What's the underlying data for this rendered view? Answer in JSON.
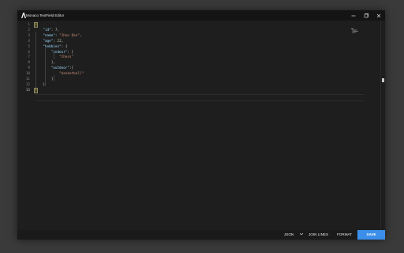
{
  "window": {
    "title": "Monaco TextField Editor",
    "controls": [
      "minimize-icon",
      "restore-icon",
      "close-icon"
    ]
  },
  "editor": {
    "language": "JSON",
    "active_line": 13,
    "line_numbers": [
      "1",
      "2",
      "3",
      "4",
      "5",
      "6",
      "7",
      "8",
      "9",
      "10",
      "11",
      "12",
      "13"
    ],
    "lines": [
      [
        {
          "t": "{",
          "c": "brace"
        }
      ],
      [
        {
          "t": "    ",
          "c": "punc"
        },
        {
          "t": "\"id\"",
          "c": "key"
        },
        {
          "t": ": ",
          "c": "punc"
        },
        {
          "t": "7",
          "c": "num"
        },
        {
          "t": ",",
          "c": "punc"
        }
      ],
      [
        {
          "t": "    ",
          "c": "punc"
        },
        {
          "t": "\"name\"",
          "c": "key"
        },
        {
          "t": ": ",
          "c": "punc"
        },
        {
          "t": "\"Jhon Doe\"",
          "c": "str"
        },
        {
          "t": ",",
          "c": "punc"
        }
      ],
      [
        {
          "t": "    ",
          "c": "punc"
        },
        {
          "t": "\"age\"",
          "c": "key"
        },
        {
          "t": ": ",
          "c": "punc"
        },
        {
          "t": "22",
          "c": "num"
        },
        {
          "t": ",",
          "c": "punc"
        }
      ],
      [
        {
          "t": "    ",
          "c": "punc"
        },
        {
          "t": "\"hobbies\"",
          "c": "key"
        },
        {
          "t": ": {",
          "c": "punc"
        }
      ],
      [
        {
          "t": "        ",
          "c": "punc"
        },
        {
          "t": "\"indoor\"",
          "c": "key"
        },
        {
          "t": ": [",
          "c": "punc"
        }
      ],
      [
        {
          "t": "            ",
          "c": "punc"
        },
        {
          "t": "\"Chess\"",
          "c": "str"
        }
      ],
      [
        {
          "t": "        ],",
          "c": "punc"
        }
      ],
      [
        {
          "t": "        ",
          "c": "punc"
        },
        {
          "t": "\"outdoor\"",
          "c": "key"
        },
        {
          "t": ":[",
          "c": "punc"
        }
      ],
      [
        {
          "t": "            ",
          "c": "punc"
        },
        {
          "t": "\"basketball\"",
          "c": "str"
        }
      ],
      [
        {
          "t": "        ]",
          "c": "punc"
        }
      ],
      [
        {
          "t": "    }",
          "c": "punc"
        }
      ],
      [
        {
          "t": "}",
          "c": "brace"
        }
      ]
    ]
  },
  "statusbar": {
    "language_label": "JSON",
    "join_lines_label": "JOIN LINES",
    "format_label": "FORMAT",
    "save_label": "SAVE"
  },
  "colors": {
    "accent": "#3b8eea",
    "key": "#9cdcfe",
    "string": "#ce9178",
    "number": "#b5cea8",
    "bracket_match": "#ffd700"
  }
}
